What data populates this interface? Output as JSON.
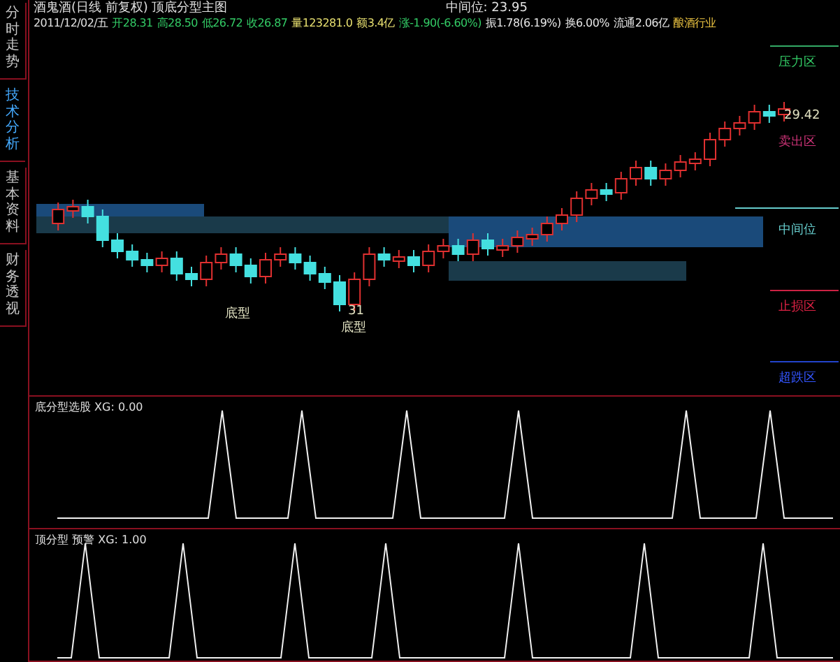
{
  "sidebar": {
    "tabs": [
      {
        "label": "分时走势",
        "selected": false
      },
      {
        "label": "技术分析",
        "selected": true
      },
      {
        "label": "基本资料",
        "selected": false
      },
      {
        "label": "财务透视",
        "selected": false
      }
    ]
  },
  "header": {
    "title": "酒鬼酒(日线 前复权) 顶底分型主图",
    "mid_label": "中间位:",
    "mid_value": "23.95"
  },
  "quote": {
    "date": "2011/12/02/五",
    "fields": [
      {
        "text": "开28.31",
        "color": "#33cc66"
      },
      {
        "text": "高28.50",
        "color": "#33cc66"
      },
      {
        "text": "低26.72",
        "color": "#33cc66"
      },
      {
        "text": "收26.87",
        "color": "#33cc66"
      },
      {
        "text": "量123281.0",
        "color": "#e8e070"
      },
      {
        "text": "额3.4亿",
        "color": "#e8e070"
      },
      {
        "text": "涨-1.90(-6.60%)",
        "color": "#33cc66"
      },
      {
        "text": "振1.78(6.19%)",
        "color": "#e8e8e8"
      },
      {
        "text": "换6.00%",
        "color": "#e8e8e8"
      },
      {
        "text": "流通2.06亿",
        "color": "#e8e8e8"
      },
      {
        "text": "酿酒行业",
        "color": "#e8c040"
      }
    ]
  },
  "chart": {
    "zone_labels": [
      {
        "text": "压力区",
        "color": "#33cc66"
      },
      {
        "text": "卖出区",
        "color": "#cc3377"
      },
      {
        "text": "中间位",
        "color": "#66cccc"
      },
      {
        "text": "止损区",
        "color": "#dd2244"
      },
      {
        "text": "超跌区",
        "color": "#3355ff"
      }
    ],
    "price_labels": [
      {
        "text": "29.42"
      },
      {
        "text": "31"
      },
      {
        "text": "底型"
      },
      {
        "text": "底型"
      }
    ]
  },
  "panels": [
    {
      "title": "底分型选股 XG: 0.00"
    },
    {
      "title": "顶分型 预警 XG: 1.00"
    }
  ]
}
